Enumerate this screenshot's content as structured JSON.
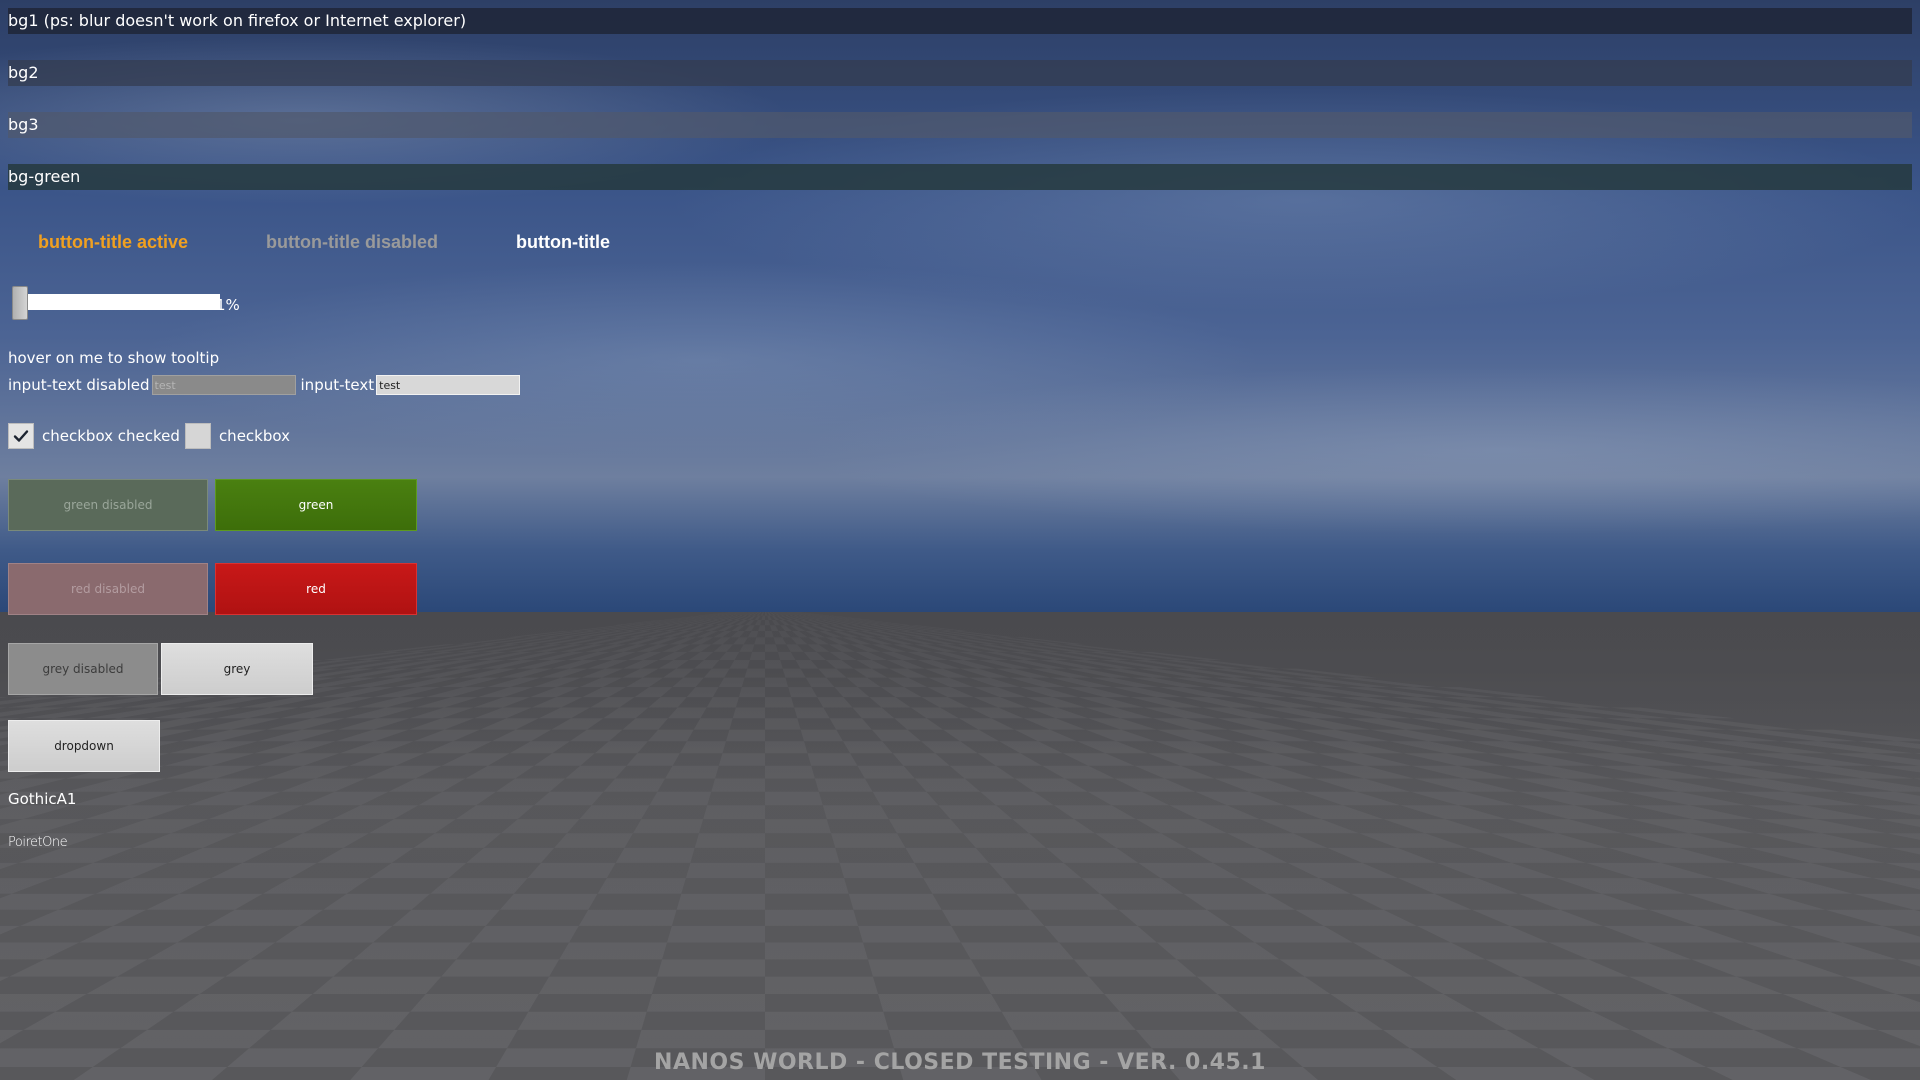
{
  "backgrounds": {
    "bg1_label": "bg1 (ps: blur doesn't work on firefox or Internet explorer)",
    "bg2_label": "bg2",
    "bg3_label": "bg3",
    "bg_green_label": "bg-green"
  },
  "button_titles": {
    "active_label": "button-title active",
    "disabled_label": "button-title disabled",
    "normal_label": "button-title"
  },
  "slider": {
    "value": 0.01,
    "value_label": "1%"
  },
  "tooltip": {
    "trigger_label": "hover on me to show tooltip"
  },
  "inputs": {
    "disabled_label": "input-text disabled",
    "disabled_value": "test",
    "enabled_label": "input-text",
    "enabled_value": "test"
  },
  "checkboxes": {
    "checked_label": "checkbox checked",
    "checked_state": true,
    "unchecked_label": "checkbox",
    "unchecked_state": false
  },
  "buttons": {
    "green_disabled": "green disabled",
    "green": "green",
    "red_disabled": "red disabled",
    "red": "red",
    "grey_disabled": "grey disabled",
    "grey": "grey",
    "dropdown": "dropdown"
  },
  "font_samples": {
    "gothic": "GothicA1",
    "poiret": "PoiretOne"
  },
  "footer": {
    "version_text": "NANOS WORLD - CLOSED TESTING - VER. 0.45.1"
  },
  "colors": {
    "accent_active": "#f0a020",
    "green": "#4a8010",
    "red": "#c81818"
  },
  "icons": {
    "checkbox_checked": "checkmark-icon"
  }
}
